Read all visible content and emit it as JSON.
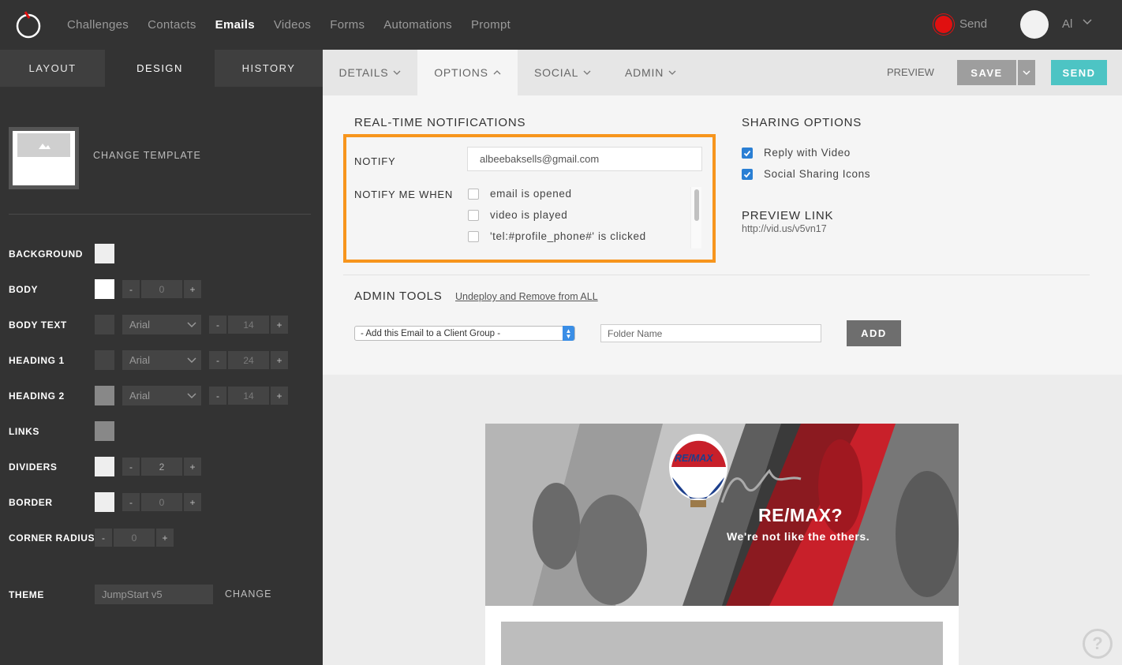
{
  "topnav": {
    "items": [
      "Challenges",
      "Contacts",
      "Emails",
      "Videos",
      "Forms",
      "Automations",
      "Prompt"
    ],
    "active_index": 2,
    "send_label": "Send",
    "user_initials": "Al"
  },
  "left": {
    "tabs": [
      "LAYOUT",
      "DESIGN",
      "HISTORY"
    ],
    "active_tab": "DESIGN",
    "change_template": "CHANGE TEMPLATE",
    "rows": {
      "background": {
        "label": "BACKGROUND",
        "color": "#eeeeee"
      },
      "body": {
        "label": "BODY",
        "color": "#ffffff",
        "value": "0"
      },
      "body_text": {
        "label": "BODY TEXT",
        "color": "#444444",
        "font": "Arial",
        "size": "14"
      },
      "heading1": {
        "label": "HEADING 1",
        "color": "#444444",
        "font": "Arial",
        "size": "24"
      },
      "heading2": {
        "label": "HEADING 2",
        "color": "#888888",
        "font": "Arial",
        "size": "14"
      },
      "links": {
        "label": "LINKS",
        "color": "#888888"
      },
      "dividers": {
        "label": "DIVIDERS",
        "color": "#eeeeee",
        "value": "2"
      },
      "border": {
        "label": "BORDER",
        "color": "#eeeeee",
        "value": "0"
      },
      "corner_radius": {
        "label": "CORNER RADIUS",
        "value": "0"
      }
    },
    "stepper_minus": "-",
    "stepper_plus": "+",
    "theme": {
      "label": "THEME",
      "value": "JumpStart v5",
      "change": "CHANGE"
    }
  },
  "subnav": {
    "tabs": [
      "DETAILS",
      "OPTIONS",
      "SOCIAL",
      "ADMIN"
    ],
    "active_tab": "OPTIONS",
    "preview": "PREVIEW",
    "save": "SAVE",
    "send": "SEND"
  },
  "options": {
    "rt_title": "REAL-TIME NOTIFICATIONS",
    "notify_label": "NOTIFY",
    "notify_value": "albeebaksells@gmail.com",
    "notify_when_label": "NOTIFY ME WHEN",
    "notify_when": [
      {
        "label": "email is opened",
        "checked": false
      },
      {
        "label": "video is played",
        "checked": false
      },
      {
        "label": "'tel:#profile_phone#' is clicked",
        "checked": false
      }
    ],
    "sharing_title": "SHARING OPTIONS",
    "sharing": [
      {
        "label": "Reply with Video",
        "checked": true
      },
      {
        "label": "Social Sharing Icons",
        "checked": true
      }
    ],
    "preview_link_title": "PREVIEW LINK",
    "preview_link_url": "http://vid.us/v5vn17",
    "admin_title": "ADMIN TOOLS",
    "undeploy": "Undeploy and Remove from ALL",
    "group_select": "- Add this Email to a Client Group -",
    "folder_placeholder": "Folder Name",
    "add": "ADD"
  },
  "preview": {
    "balloon": "RE/MAX",
    "headline_script": "WHY",
    "headline": "RE/MAX?",
    "tagline": "We're not like the others."
  },
  "colors": {
    "highlight": "#f7951d",
    "send_btn": "#4dc4c4",
    "checkbox": "#2a7fd4",
    "record": "#e01010"
  },
  "icons": [
    "logo-icon",
    "record-icon",
    "chevron-down-icon",
    "chevron-up-icon",
    "help-icon",
    "image-icon"
  ]
}
